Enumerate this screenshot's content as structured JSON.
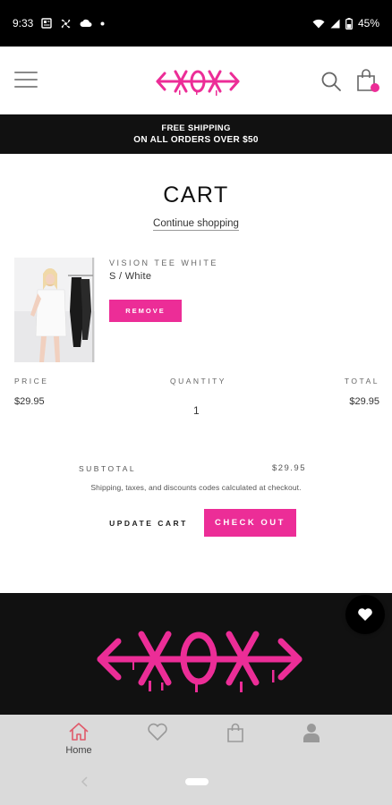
{
  "status_bar": {
    "time": "9:33",
    "battery": "45%"
  },
  "header": {
    "logo_text": "XOX",
    "cart_badge_color": "#ec2d97"
  },
  "banner": {
    "line1": "FREE SHIPPING",
    "line2": "ON ALL ORDERS OVER $50"
  },
  "cart": {
    "title": "CART",
    "continue_label": "Continue shopping",
    "item": {
      "name": "VISION TEE WHITE",
      "variant": "S / White",
      "remove_label": "REMOVE",
      "price": "$29.95",
      "quantity": "1",
      "total": "$29.95"
    },
    "columns": {
      "price": "PRICE",
      "quantity": "QUANTITY",
      "total": "TOTAL"
    },
    "subtotal_label": "SUBTOTAL",
    "subtotal_value": "$29.95",
    "shipping_note": "Shipping, taxes, and discounts codes calculated at checkout.",
    "update_label": "UPDATE CART",
    "checkout_label": "CHECK OUT"
  },
  "colors": {
    "accent": "#ec2d97",
    "dark": "#111111",
    "nav_bg": "#dadada",
    "nav_active": "#e05a6a"
  },
  "bottom_nav": {
    "items": [
      {
        "label": "Home",
        "icon": "home-icon",
        "active": true
      },
      {
        "label": "",
        "icon": "heart-icon",
        "active": false
      },
      {
        "label": "",
        "icon": "shopping-bag-icon",
        "active": false
      },
      {
        "label": "",
        "icon": "user-icon",
        "active": false
      }
    ]
  }
}
